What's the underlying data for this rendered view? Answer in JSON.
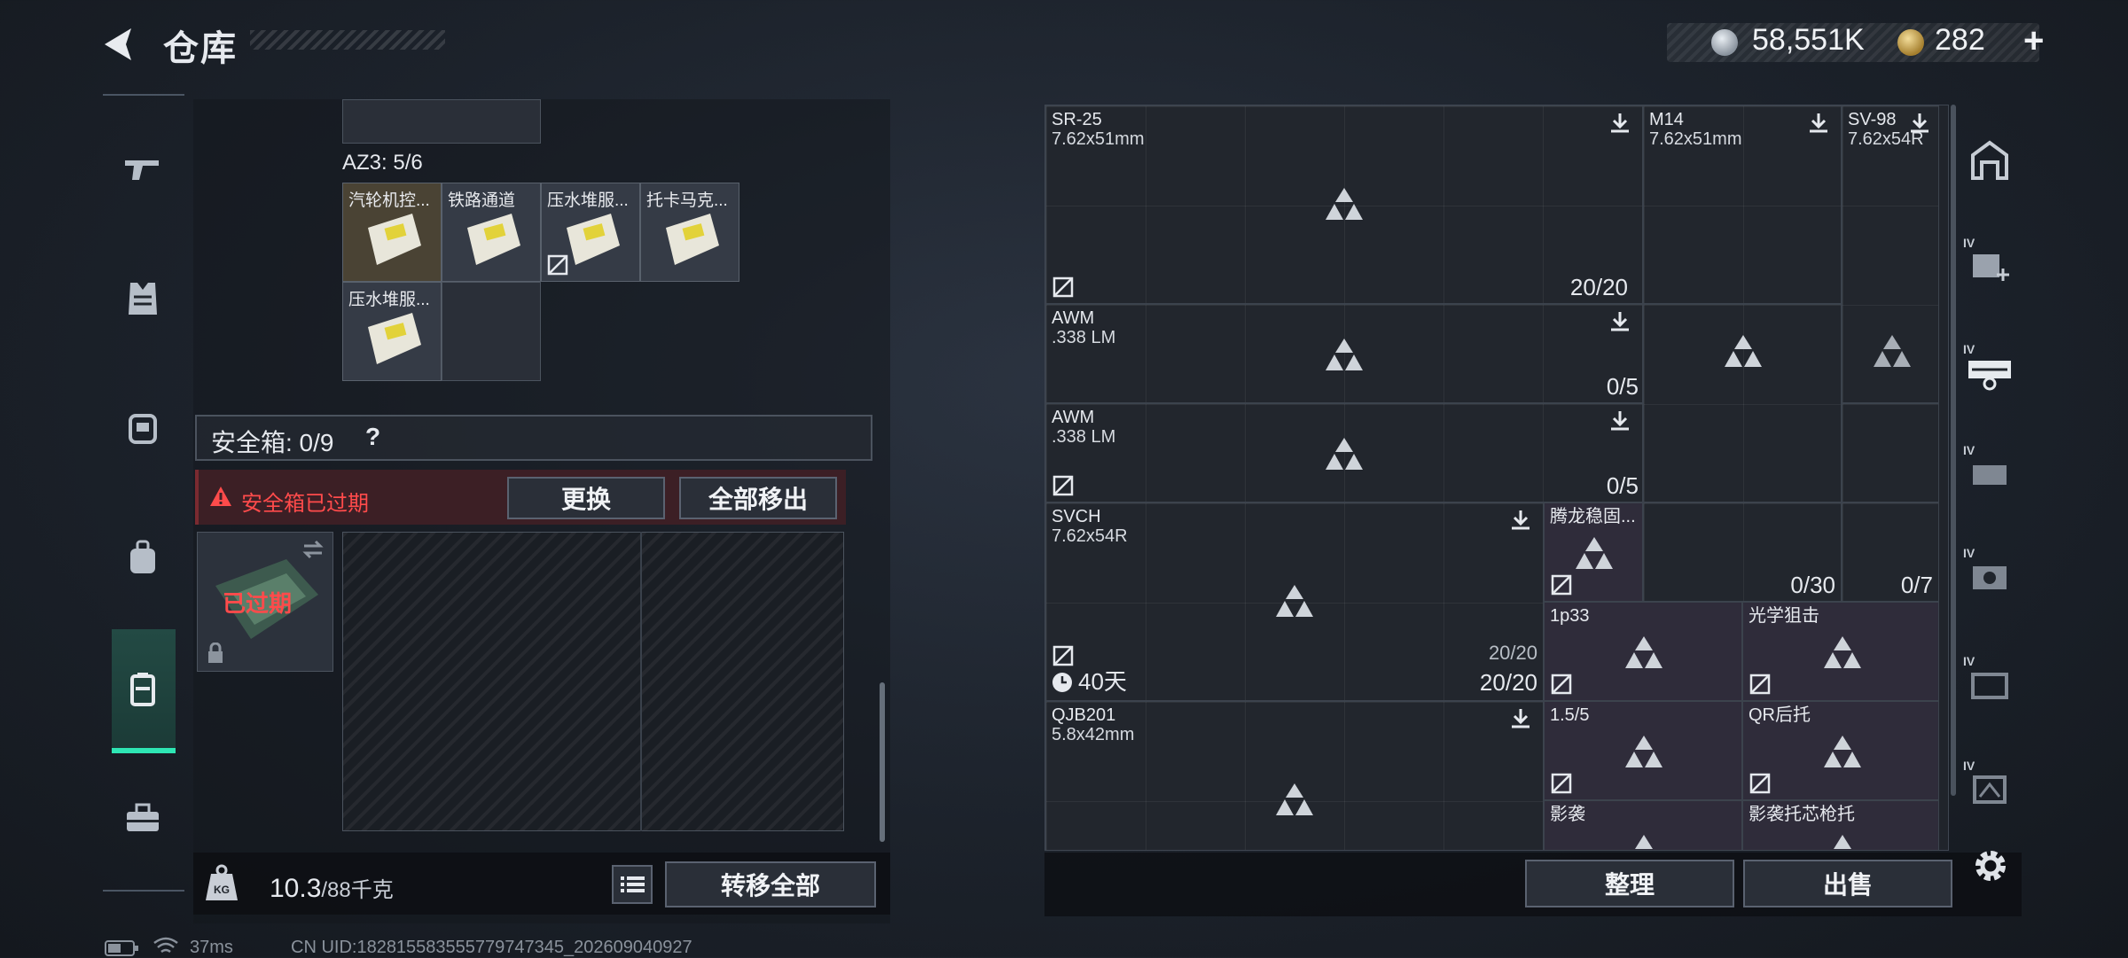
{
  "header": {
    "title": "仓库",
    "currency_money": "58,551K",
    "currency_gold": "282",
    "add_label": "+"
  },
  "left": {
    "az3_label": "AZ3: 5/6",
    "items": [
      {
        "label": "汽轮机控..."
      },
      {
        "label": "铁路通道"
      },
      {
        "label": "压水堆服..."
      },
      {
        "label": "托卡马克..."
      },
      {
        "label": "压水堆服..."
      }
    ],
    "safe_box": {
      "title": "安全箱: 0/9",
      "help": "?",
      "expired_warning": "安全箱已过期",
      "replace_btn": "更换",
      "move_all_btn": "全部移出",
      "case_status": "已过期"
    },
    "weight": {
      "current": "10.3",
      "max": "/88千克"
    },
    "transfer_all_btn": "转移全部"
  },
  "right": {
    "cells": [
      {
        "name": "SR-25",
        "caliber": "7.62x51mm",
        "count": "20/20"
      },
      {
        "name": "M14",
        "caliber": "7.62x51mm"
      },
      {
        "name": "SV-98",
        "caliber": "7.62x54R"
      },
      {
        "name": "AWM",
        "caliber": ".338 LM",
        "count": "0/5"
      },
      {
        "name": "AWM",
        "caliber": ".338 LM",
        "count": "0/5"
      },
      {
        "name": "SVCH",
        "caliber": "7.62x54R",
        "count": "20/20",
        "count_small": "20/20",
        "timer": "40天"
      },
      {
        "name": "腾龙稳固..."
      },
      {
        "name": "",
        "count": "0/30"
      },
      {
        "name": "",
        "count": "0/7"
      },
      {
        "name": "1p33"
      },
      {
        "name": "光学狙击"
      },
      {
        "name": "QJB201",
        "caliber": "5.8x42mm"
      },
      {
        "name": "1.5/5"
      },
      {
        "name": "QR后托"
      },
      {
        "name": "影袭"
      },
      {
        "name": "影袭托芯枪托"
      }
    ],
    "sort_btn": "整理",
    "sell_btn": "出售"
  },
  "side_rail": {
    "tag": "IV"
  },
  "status": {
    "ping": "37ms",
    "uid": "CN UID:1828155835557797473​45_202609040927"
  }
}
